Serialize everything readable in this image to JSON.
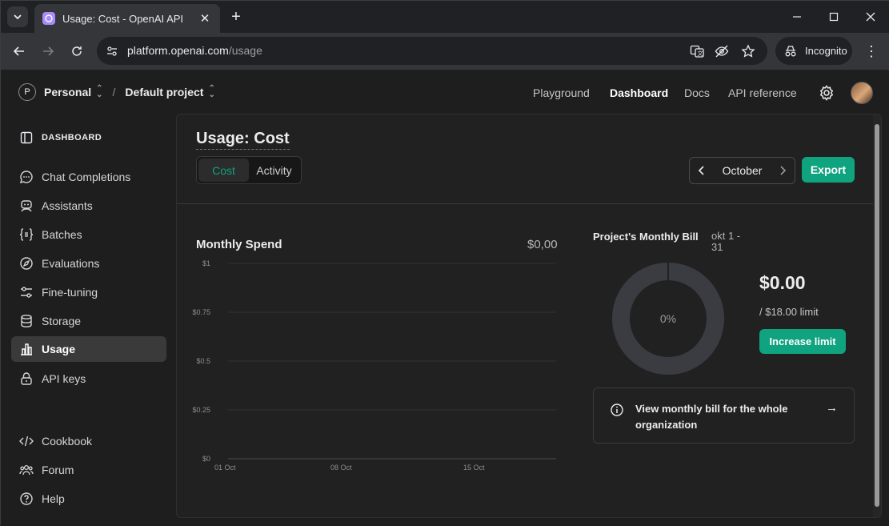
{
  "browser": {
    "tab_title": "Usage: Cost - OpenAI API",
    "url_host": "platform.openai.com",
    "url_path": "/usage",
    "incognito_label": "Incognito"
  },
  "header": {
    "org_initial": "P",
    "org_name": "Personal",
    "separator": "/",
    "project_name": "Default project",
    "links": [
      "Playground",
      "Dashboard",
      "Docs",
      "API reference"
    ],
    "active_link": "Dashboard"
  },
  "sidebar": {
    "heading": "DASHBOARD",
    "items": [
      {
        "label": "Chat Completions",
        "icon": "chat-icon"
      },
      {
        "label": "Assistants",
        "icon": "robot-icon"
      },
      {
        "label": "Batches",
        "icon": "braces-icon"
      },
      {
        "label": "Evaluations",
        "icon": "compass-icon"
      },
      {
        "label": "Fine-tuning",
        "icon": "sliders-icon"
      },
      {
        "label": "Storage",
        "icon": "database-icon"
      },
      {
        "label": "Usage",
        "icon": "bar-chart-icon",
        "active": true
      },
      {
        "label": "API keys",
        "icon": "lock-icon"
      }
    ],
    "footer": [
      {
        "label": "Cookbook",
        "icon": "code-icon"
      },
      {
        "label": "Forum",
        "icon": "people-icon"
      },
      {
        "label": "Help",
        "icon": "help-icon"
      }
    ]
  },
  "main": {
    "title": "Usage: Cost",
    "tabs": [
      "Cost",
      "Activity"
    ],
    "active_tab": "Cost",
    "month": "October",
    "export_label": "Export",
    "spend_title": "Monthly Spend",
    "spend_value": "$0,00",
    "bill_title": "Project's Monthly Bill",
    "bill_range": "okt 1 - 31",
    "bill_percent": "0%",
    "bill_amount": "$0.00",
    "bill_limit": "/ $18.00 limit",
    "increase_label": "Increase limit",
    "org_link": "View monthly bill for the whole organization",
    "colors": {
      "accent": "#10a37f",
      "donut": "#3b3c42"
    }
  },
  "chart_data": {
    "type": "bar",
    "title": "Monthly Spend",
    "y_ticks": [
      "$1",
      "$0.75",
      "$0.5",
      "$0.25",
      "$0"
    ],
    "x_ticks": [
      "01 Oct",
      "08 Oct",
      "15 Oct"
    ],
    "ylim": [
      0,
      1
    ],
    "values": []
  }
}
